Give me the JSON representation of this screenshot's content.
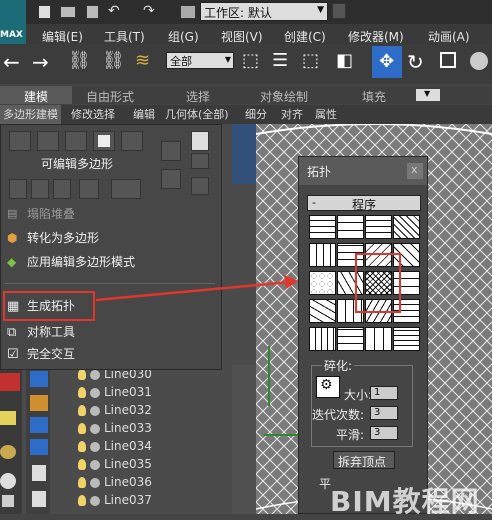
{
  "toolbar": {
    "logo_text": "MAX",
    "workspace_label": "工作区: 默认",
    "filter_value": "全部"
  },
  "menu": [
    "编辑(E)",
    "工具(T)",
    "组(G)",
    "视图(V)",
    "创建(C)",
    "修改器(M)",
    "动画(A)"
  ],
  "ribbon_tabs1": [
    "建模",
    "自由形式",
    "选择",
    "对象绘制",
    "填充"
  ],
  "ribbon_tabs2": [
    "多边形建模",
    "修改选择",
    "编辑",
    "几何体(全部)",
    "细分",
    "对齐",
    "属性"
  ],
  "left_menu": {
    "header": "可编辑多边形",
    "collapse_stack": "塌陷堆叠",
    "convert_to_poly": "转化为多边形",
    "apply_edit_poly": "应用编辑多边形模式",
    "generate_topology": "生成拓扑",
    "symmetry_tool": "对称工具",
    "full_interaction": "完全交互"
  },
  "line_items": [
    "Line030",
    "Line031",
    "Line032",
    "Line033",
    "Line034",
    "Line035",
    "Line036",
    "Line037"
  ],
  "topology_dialog": {
    "title": "拓扑",
    "close_label": "x",
    "program_toggle": "-",
    "program_header": "程序",
    "subdivide_label": "碎化:",
    "size_label": "大小:",
    "size_value": "1",
    "iterations_label": "迭代次数:",
    "iterations_value": "3",
    "smooth_label": "平滑:",
    "smooth_value": "3",
    "discard_vertices_button": "拆弃顶点",
    "bottom_partial": "平"
  },
  "watermark": "BIM教程网",
  "colors": {
    "highlight_red": "#e0362b",
    "active_blue": "#2f6cc7",
    "panel_bg": "#444444"
  }
}
